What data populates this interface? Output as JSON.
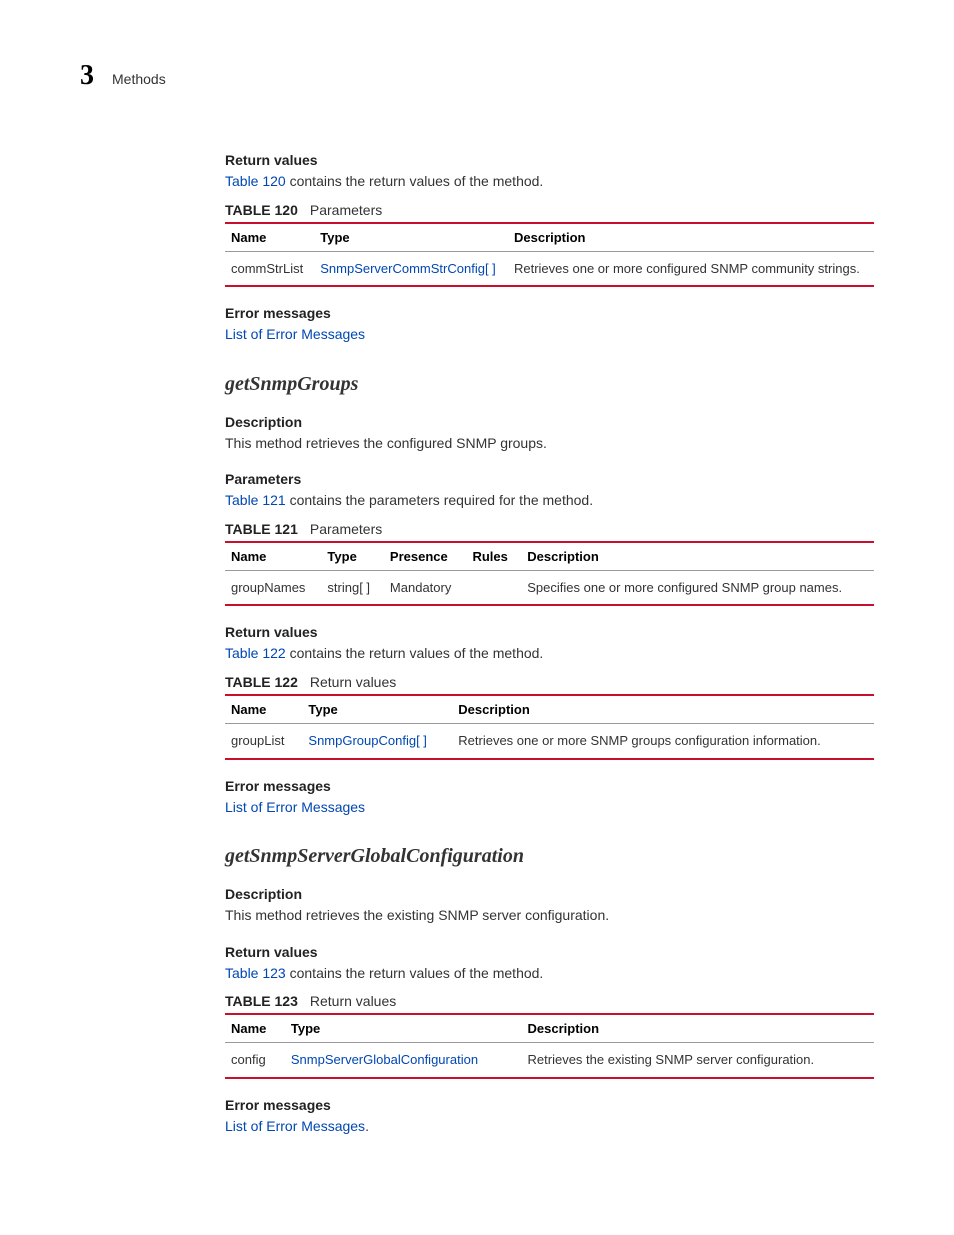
{
  "header": {
    "chapter_num": "3",
    "breadcrumb": "Methods"
  },
  "s1": {
    "return_values_h": "Return values",
    "return_values_intro_link": "Table 120",
    "return_values_intro_rest": " contains the return values of the method.",
    "table_num": "TABLE 120",
    "table_title": "Parameters",
    "th_name": "Name",
    "th_type": "Type",
    "th_desc": "Description",
    "r_name": "commStrList",
    "r_type": "SnmpServerCommStrConfig[ ]",
    "r_desc": "Retrieves one or more configured SNMP community strings.",
    "err_h": "Error messages",
    "err_link": "List of Error Messages"
  },
  "m2": {
    "title": "getSnmpGroups",
    "desc_h": "Description",
    "desc_body": "This method retrieves the configured SNMP groups.",
    "param_h": "Parameters",
    "param_intro_link": "Table 121",
    "param_intro_rest": " contains the parameters required for the method.",
    "t121_num": "TABLE 121",
    "t121_title": "Parameters",
    "th_name": "Name",
    "th_type": "Type",
    "th_presence": "Presence",
    "th_rules": "Rules",
    "th_desc": "Description",
    "p_name": "groupNames",
    "p_type": "string[ ]",
    "p_presence": "Mandatory",
    "p_rules": "",
    "p_desc": "Specifies one or more configured SNMP group names.",
    "ret_h": "Return values",
    "ret_intro_link": "Table 122",
    "ret_intro_rest": " contains the return values of the method.",
    "t122_num": "TABLE 122",
    "t122_title": "Return values",
    "rth_name": "Name",
    "rth_type": "Type",
    "rth_desc": "Description",
    "r_name": "groupList",
    "r_type": "SnmpGroupConfig[ ]",
    "r_desc": "Retrieves one or more SNMP groups configuration information.",
    "err_h": "Error messages",
    "err_link": "List of Error Messages"
  },
  "m3": {
    "title": "getSnmpServerGlobalConfiguration",
    "desc_h": "Description",
    "desc_body": "This method retrieves the existing SNMP server configuration.",
    "ret_h": "Return values",
    "ret_intro_link": "Table 123",
    "ret_intro_rest": " contains the return values of the method.",
    "t123_num": "TABLE 123",
    "t123_title": "Return values",
    "rth_name": "Name",
    "rth_type": "Type",
    "rth_desc": "Description",
    "r_name": "config",
    "r_type": "SnmpServerGlobalConfiguration",
    "r_desc": "Retrieves the existing SNMP server configuration.",
    "err_h": "Error messages",
    "err_link": "List of Error Messages",
    "err_period": "."
  }
}
